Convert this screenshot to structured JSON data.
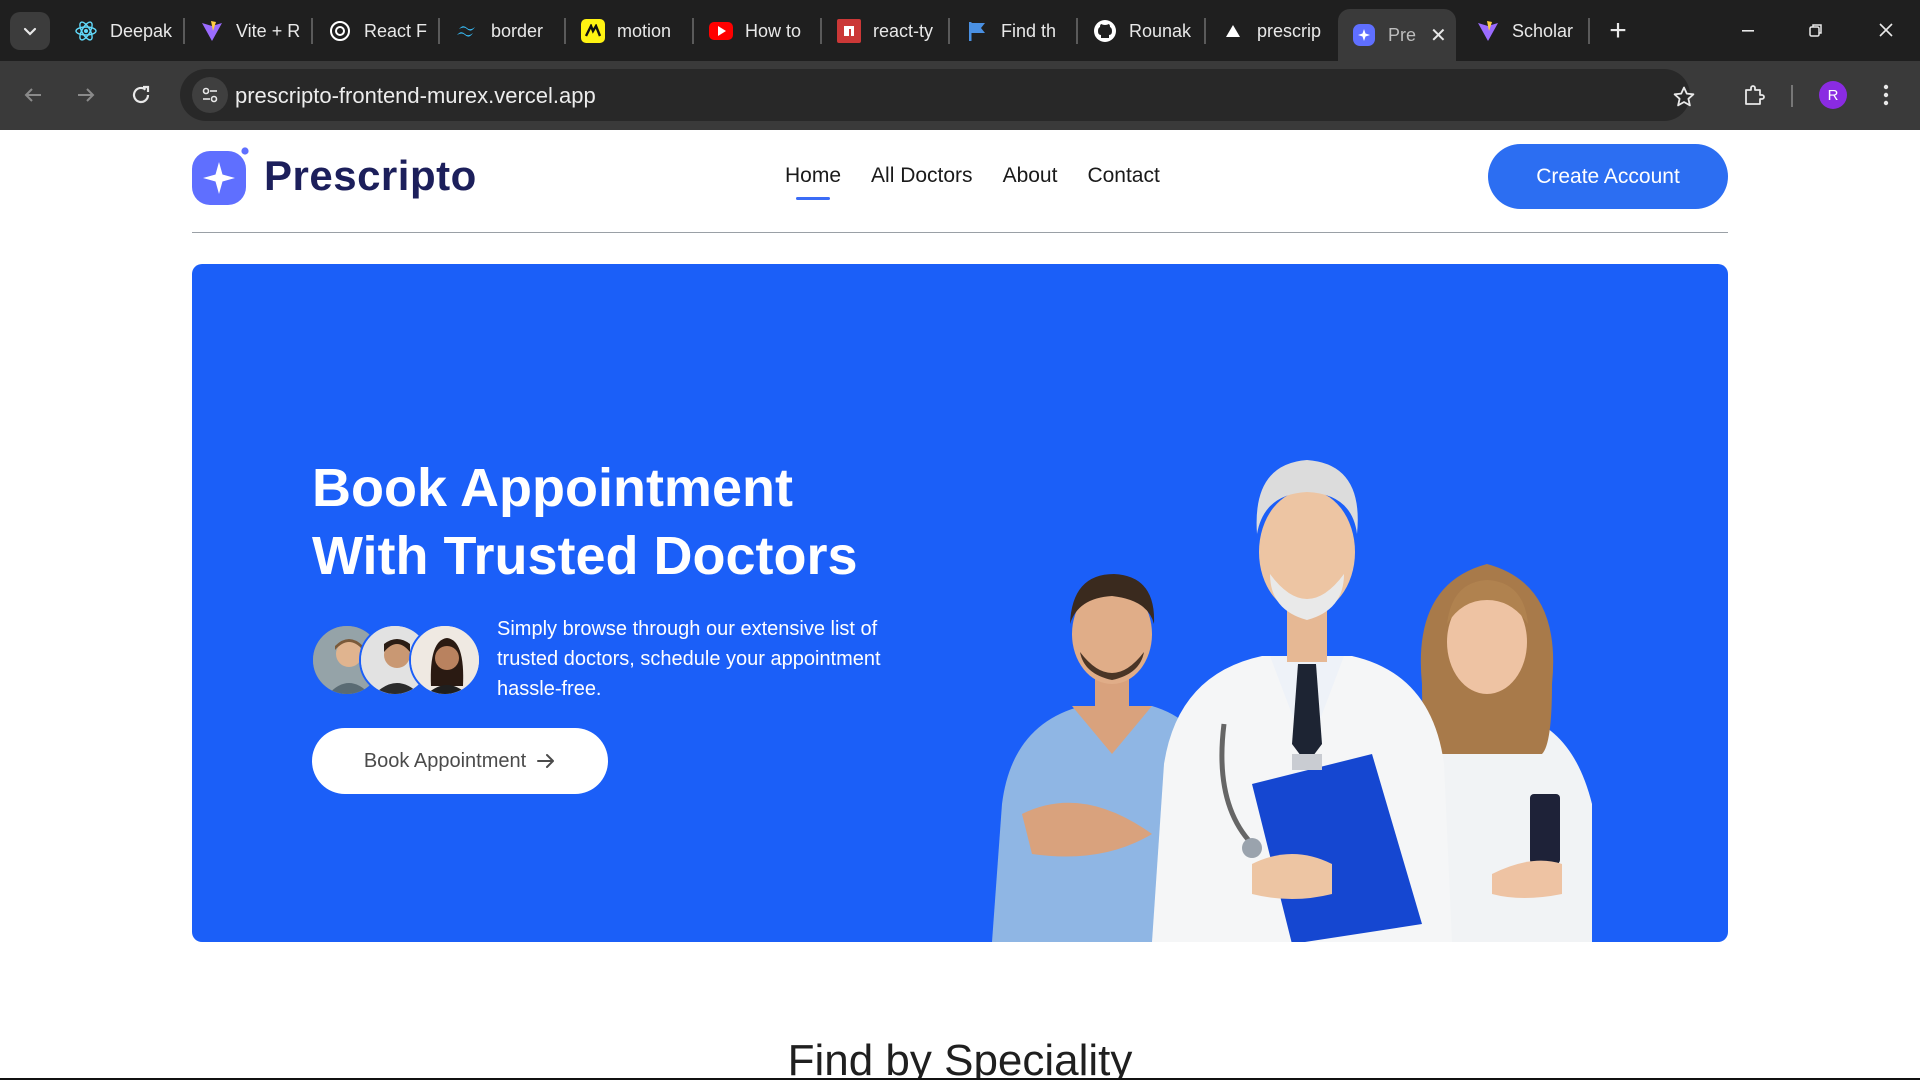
{
  "browser": {
    "tabs": [
      {
        "label": "Deepak",
        "icon": "react-icon",
        "fav_color": "#61dafb"
      },
      {
        "label": "Vite + R",
        "icon": "vite-icon",
        "fav_color": "#9b6bff"
      },
      {
        "label": "React F",
        "icon": "openai-icon",
        "fav_color": "#ffffff"
      },
      {
        "label": "border",
        "icon": "tailwind-icon",
        "fav_color": "#38bdf8"
      },
      {
        "label": "motion",
        "icon": "motion-icon",
        "fav_color": "#fff312"
      },
      {
        "label": "How to",
        "icon": "youtube-icon",
        "fav_color": "#ff0000"
      },
      {
        "label": "react-ty",
        "icon": "npm-icon",
        "fav_color": "#cb3837"
      },
      {
        "label": "Find th",
        "icon": "flag-icon",
        "fav_color": "#4a90e2"
      },
      {
        "label": "Rounak",
        "icon": "github-icon",
        "fav_color": "#ffffff"
      },
      {
        "label": "prescrip",
        "icon": "vercel-icon",
        "fav_color": "#ffffff"
      },
      {
        "label": "Pre",
        "icon": "prescripto-icon",
        "fav_color": "#5f6fff",
        "active": true
      },
      {
        "label": "Scholar",
        "icon": "vite-icon",
        "fav_color": "#9b6bff"
      }
    ],
    "url": "prescripto-frontend-murex.vercel.app",
    "profile_initial": "R"
  },
  "site": {
    "brand": "Prescripto",
    "nav": [
      "Home",
      "All Doctors",
      "About",
      "Contact"
    ],
    "active_nav": "Home",
    "cta_label": "Create Account"
  },
  "hero": {
    "title_line1": "Book Appointment",
    "title_line2": "With Trusted Doctors",
    "description": "Simply browse through our extensive list of trusted doctors, schedule your appointment hassle-free.",
    "button_label": "Book Appointment",
    "background_color": "#1b5ff8"
  },
  "section": {
    "title": "Find by Speciality"
  },
  "colors": {
    "primary": "#2c6ef2",
    "brand_text": "#1c1f5b"
  }
}
